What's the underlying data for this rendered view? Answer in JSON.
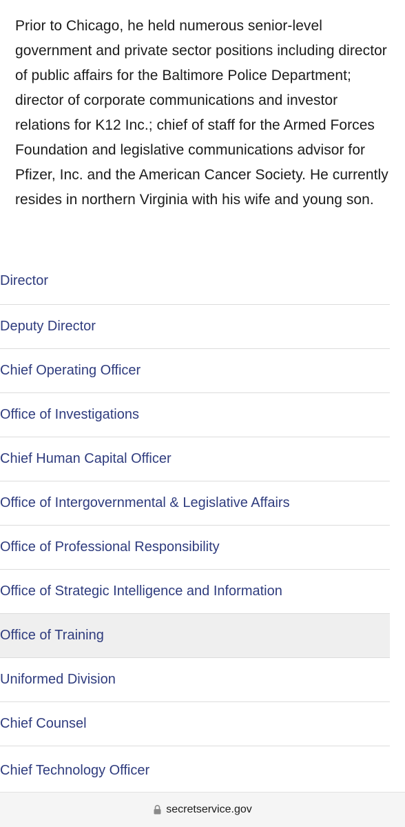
{
  "bio": {
    "text": "Prior to Chicago, he held numerous senior-level government and private sector positions including director of public affairs for the Baltimore Police Department; director of corporate communications and investor relations for K12 Inc.; chief of staff for the Armed Forces Foundation and legislative communications advisor for Pfizer, Inc. and the American Cancer Society. He currently resides in northern Virginia with his wife and young son."
  },
  "nav": {
    "items": [
      {
        "label": "Director"
      },
      {
        "label": "Deputy Director"
      },
      {
        "label": "Chief Operating Officer"
      },
      {
        "label": "Office of Investigations"
      },
      {
        "label": "Chief Human Capital Officer"
      },
      {
        "label": "Office of Intergovernmental & Legislative Affairs"
      },
      {
        "label": "Office of Professional Responsibility"
      },
      {
        "label": "Office of Strategic Intelligence and Information"
      },
      {
        "label": "Office of Training"
      },
      {
        "label": "Uniformed Division"
      },
      {
        "label": "Chief Counsel"
      },
      {
        "label": "Chief Technology Officer"
      }
    ],
    "active_label": "Office of Training"
  },
  "browser": {
    "url": "secretservice.gov",
    "icon": "lock-icon"
  },
  "colors": {
    "link": "#2f3c7e",
    "text": "#1b1b1b",
    "active_bg": "#efefef",
    "divider": "#dcdcdc"
  }
}
